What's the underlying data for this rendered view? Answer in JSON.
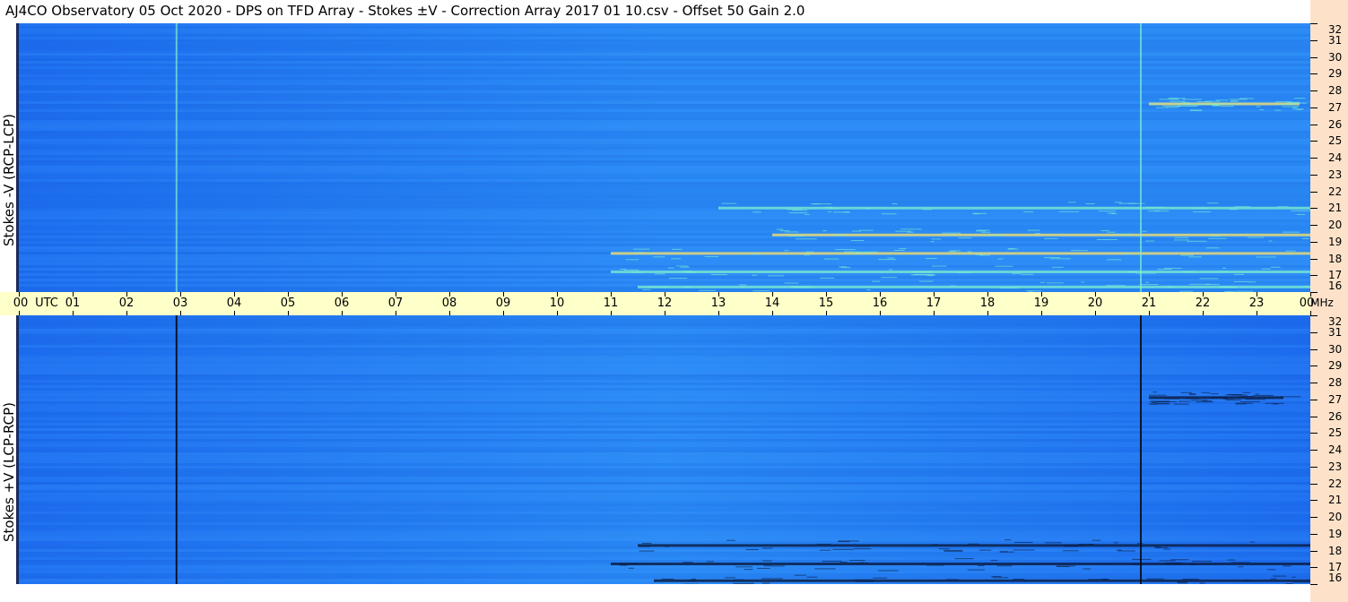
{
  "title": "AJ4CO Observatory  05 Oct 2020  -  DPS on TFD Array  -  Stokes ±V  -  Correction Array 2017 01 10.csv  -  Offset 50  Gain 2.0",
  "colors": {
    "background_low": "#1e6ef0",
    "background_mid": "#2a8af5",
    "intensity_high": "#7ff0d0",
    "intensity_peak": "#ffe86a",
    "intensity_negative": "#0a1a40",
    "time_axis_bg": "#ffffc9",
    "freq_axis_bg": "#fde2c9"
  },
  "chart_data": [
    {
      "type": "heatmap",
      "title": "",
      "ylabel": "Stokes -V (RCP-LCP)",
      "xlabel": "",
      "x_unit": "UTC",
      "y_unit": "MHz",
      "xlim": [
        0,
        24
      ],
      "ylim": [
        16,
        32
      ],
      "x_ticks": [
        "00",
        "01",
        "02",
        "03",
        "04",
        "05",
        "06",
        "07",
        "08",
        "09",
        "10",
        "11",
        "12",
        "13",
        "14",
        "15",
        "16",
        "17",
        "18",
        "19",
        "20",
        "21",
        "22",
        "23",
        "00"
      ],
      "y_ticks": [
        "32",
        "31",
        "30",
        "29",
        "28",
        "27",
        "26",
        "25",
        "24",
        "23",
        "22",
        "21",
        "20",
        "19",
        "18",
        "17",
        "16"
      ],
      "vertical_lines_utc": [
        2.93,
        20.85
      ],
      "bright_bands": [
        {
          "freq_mhz": 18.3,
          "from_utc": 11.0,
          "to_utc": 24.0
        },
        {
          "freq_mhz": 17.2,
          "from_utc": 11.0,
          "to_utc": 24.0
        },
        {
          "freq_mhz": 19.4,
          "from_utc": 14.0,
          "to_utc": 24.0
        },
        {
          "freq_mhz": 21.0,
          "from_utc": 13.0,
          "to_utc": 24.0
        },
        {
          "freq_mhz": 27.2,
          "from_utc": 21.0,
          "to_utc": 23.8
        },
        {
          "freq_mhz": 16.3,
          "from_utc": 11.5,
          "to_utc": 24.0
        }
      ]
    },
    {
      "type": "heatmap",
      "title": "",
      "ylabel": "Stokes +V (LCP-RCP)",
      "xlabel": "",
      "x_unit": "UTC",
      "y_unit": "MHz",
      "xlim": [
        0,
        24
      ],
      "ylim": [
        16,
        32
      ],
      "x_ticks": [
        "00",
        "01",
        "02",
        "03",
        "04",
        "05",
        "06",
        "07",
        "08",
        "09",
        "10",
        "11",
        "12",
        "13",
        "14",
        "15",
        "16",
        "17",
        "18",
        "19",
        "20",
        "21",
        "22",
        "23",
        "00"
      ],
      "y_ticks": [
        "32",
        "31",
        "30",
        "29",
        "28",
        "27",
        "26",
        "25",
        "24",
        "23",
        "22",
        "21",
        "20",
        "19",
        "18",
        "17",
        "16"
      ],
      "vertical_lines_utc": [
        2.93,
        20.85
      ],
      "dark_bands": [
        {
          "freq_mhz": 18.3,
          "from_utc": 11.5,
          "to_utc": 24.0
        },
        {
          "freq_mhz": 17.2,
          "from_utc": 11.0,
          "to_utc": 24.0
        },
        {
          "freq_mhz": 16.2,
          "from_utc": 11.8,
          "to_utc": 24.0
        },
        {
          "freq_mhz": 27.1,
          "from_utc": 21.0,
          "to_utc": 23.5
        }
      ]
    }
  ],
  "time_axis": {
    "unit_label": "UTC",
    "freq_unit_label": "MHz"
  }
}
